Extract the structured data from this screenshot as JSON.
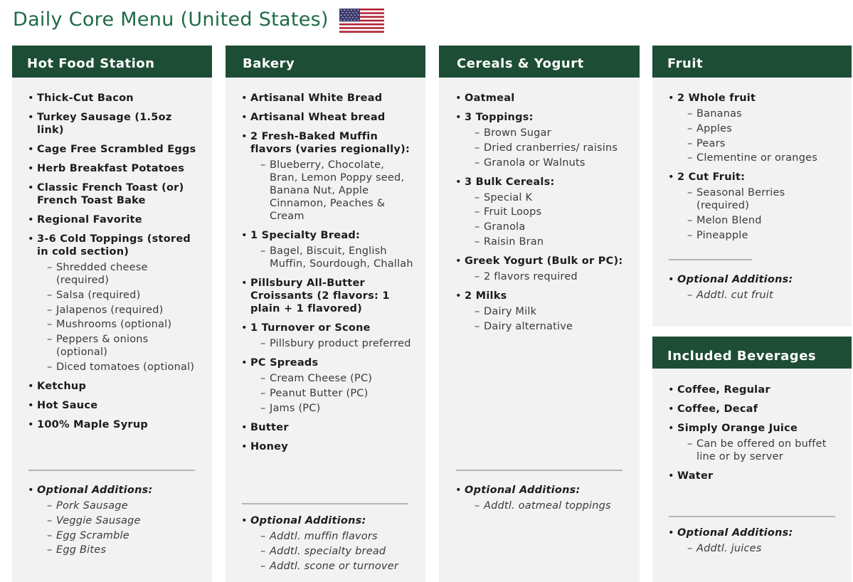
{
  "page": {
    "title": "Daily Core Menu (United States)",
    "flag_icon": "us-flag-icon"
  },
  "columns": {
    "hot": {
      "title": "Hot Food Station",
      "items": [
        {
          "label": "Thick-Cut Bacon"
        },
        {
          "label": "Turkey Sausage (1.5oz link)"
        },
        {
          "label": "Cage Free Scrambled Eggs"
        },
        {
          "label": "Herb Breakfast Potatoes"
        },
        {
          "label": "Classic French Toast (or) French Toast Bake"
        },
        {
          "label": "Regional Favorite"
        },
        {
          "label": "3-6 Cold Toppings (stored in cold section)",
          "subs": [
            "Shredded cheese (required)",
            "Salsa (required)",
            "Jalapenos (required)",
            "Mushrooms (optional)",
            "Peppers & onions (optional)",
            "Diced tomatoes (optional)"
          ]
        },
        {
          "label": "Ketchup"
        },
        {
          "label": "Hot Sauce"
        },
        {
          "label": "100% Maple Syrup"
        }
      ],
      "optional": {
        "label": "Optional Additions:",
        "subs": [
          "Pork Sausage",
          "Veggie Sausage",
          "Egg Scramble",
          "Egg Bites"
        ]
      }
    },
    "bakery": {
      "title": "Bakery",
      "items": [
        {
          "label": "Artisanal White Bread"
        },
        {
          "label": "Artisanal Wheat bread"
        },
        {
          "label": "2 Fresh-Baked Muffin flavors (varies regionally):",
          "subs": [
            "Blueberry, Chocolate, Bran, Lemon Poppy seed, Banana Nut, Apple Cinnamon, Peaches & Cream"
          ]
        },
        {
          "label": "1 Specialty Bread:",
          "subs": [
            "Bagel, Biscuit, English Muffin, Sourdough, Challah"
          ]
        },
        {
          "label": "Pillsbury All-Butter Croissants (2 flavors: 1 plain + 1 flavored)"
        },
        {
          "label": "1 Turnover or Scone",
          "subs": [
            "Pillsbury product preferred"
          ]
        },
        {
          "label": "PC Spreads",
          "subs": [
            "Cream Cheese (PC)",
            "Peanut Butter (PC)",
            "Jams (PC)"
          ]
        },
        {
          "label": "Butter"
        },
        {
          "label": "Honey"
        }
      ],
      "optional": {
        "label": "Optional Additions:",
        "subs": [
          "Addtl. muffin flavors",
          "Addtl. specialty bread",
          "Addtl. scone or turnover"
        ]
      }
    },
    "cereals": {
      "title": "Cereals & Yogurt",
      "items": [
        {
          "label": "Oatmeal"
        },
        {
          "label": "3 Toppings:",
          "subs": [
            "Brown Sugar",
            "Dried cranberries/ raisins",
            "Granola or Walnuts"
          ]
        },
        {
          "label": "3 Bulk Cereals:",
          "subs": [
            "Special K",
            "Fruit Loops",
            "Granola",
            "Raisin Bran"
          ]
        },
        {
          "label": "Greek Yogurt (Bulk or PC):",
          "subs": [
            "2 flavors required"
          ]
        },
        {
          "label": "2 Milks",
          "subs": [
            "Dairy Milk",
            "Dairy alternative"
          ]
        }
      ],
      "optional": {
        "label": "Optional Additions:",
        "subs": [
          "Addtl. oatmeal toppings"
        ]
      }
    },
    "fruit": {
      "title": "Fruit",
      "items": [
        {
          "label": "2 Whole fruit",
          "subs": [
            "Bananas",
            "Apples",
            "Pears",
            "Clementine or oranges"
          ]
        },
        {
          "label": "2 Cut Fruit:",
          "subs": [
            "Seasonal Berries (required)",
            "Melon Blend",
            "Pineapple"
          ]
        }
      ],
      "optional": {
        "label": "Optional Additions:",
        "subs": [
          "Addtl. cut fruit"
        ]
      }
    },
    "beverages": {
      "title": "Included Beverages",
      "items": [
        {
          "label": "Coffee, Regular"
        },
        {
          "label": "Coffee, Decaf"
        },
        {
          "label": "Simply Orange Juice",
          "subs": [
            "Can be offered on buffet line or by server"
          ]
        },
        {
          "label": "Water"
        }
      ],
      "optional": {
        "label": "Optional Additions:",
        "subs": [
          "Addtl. juices"
        ]
      }
    }
  }
}
